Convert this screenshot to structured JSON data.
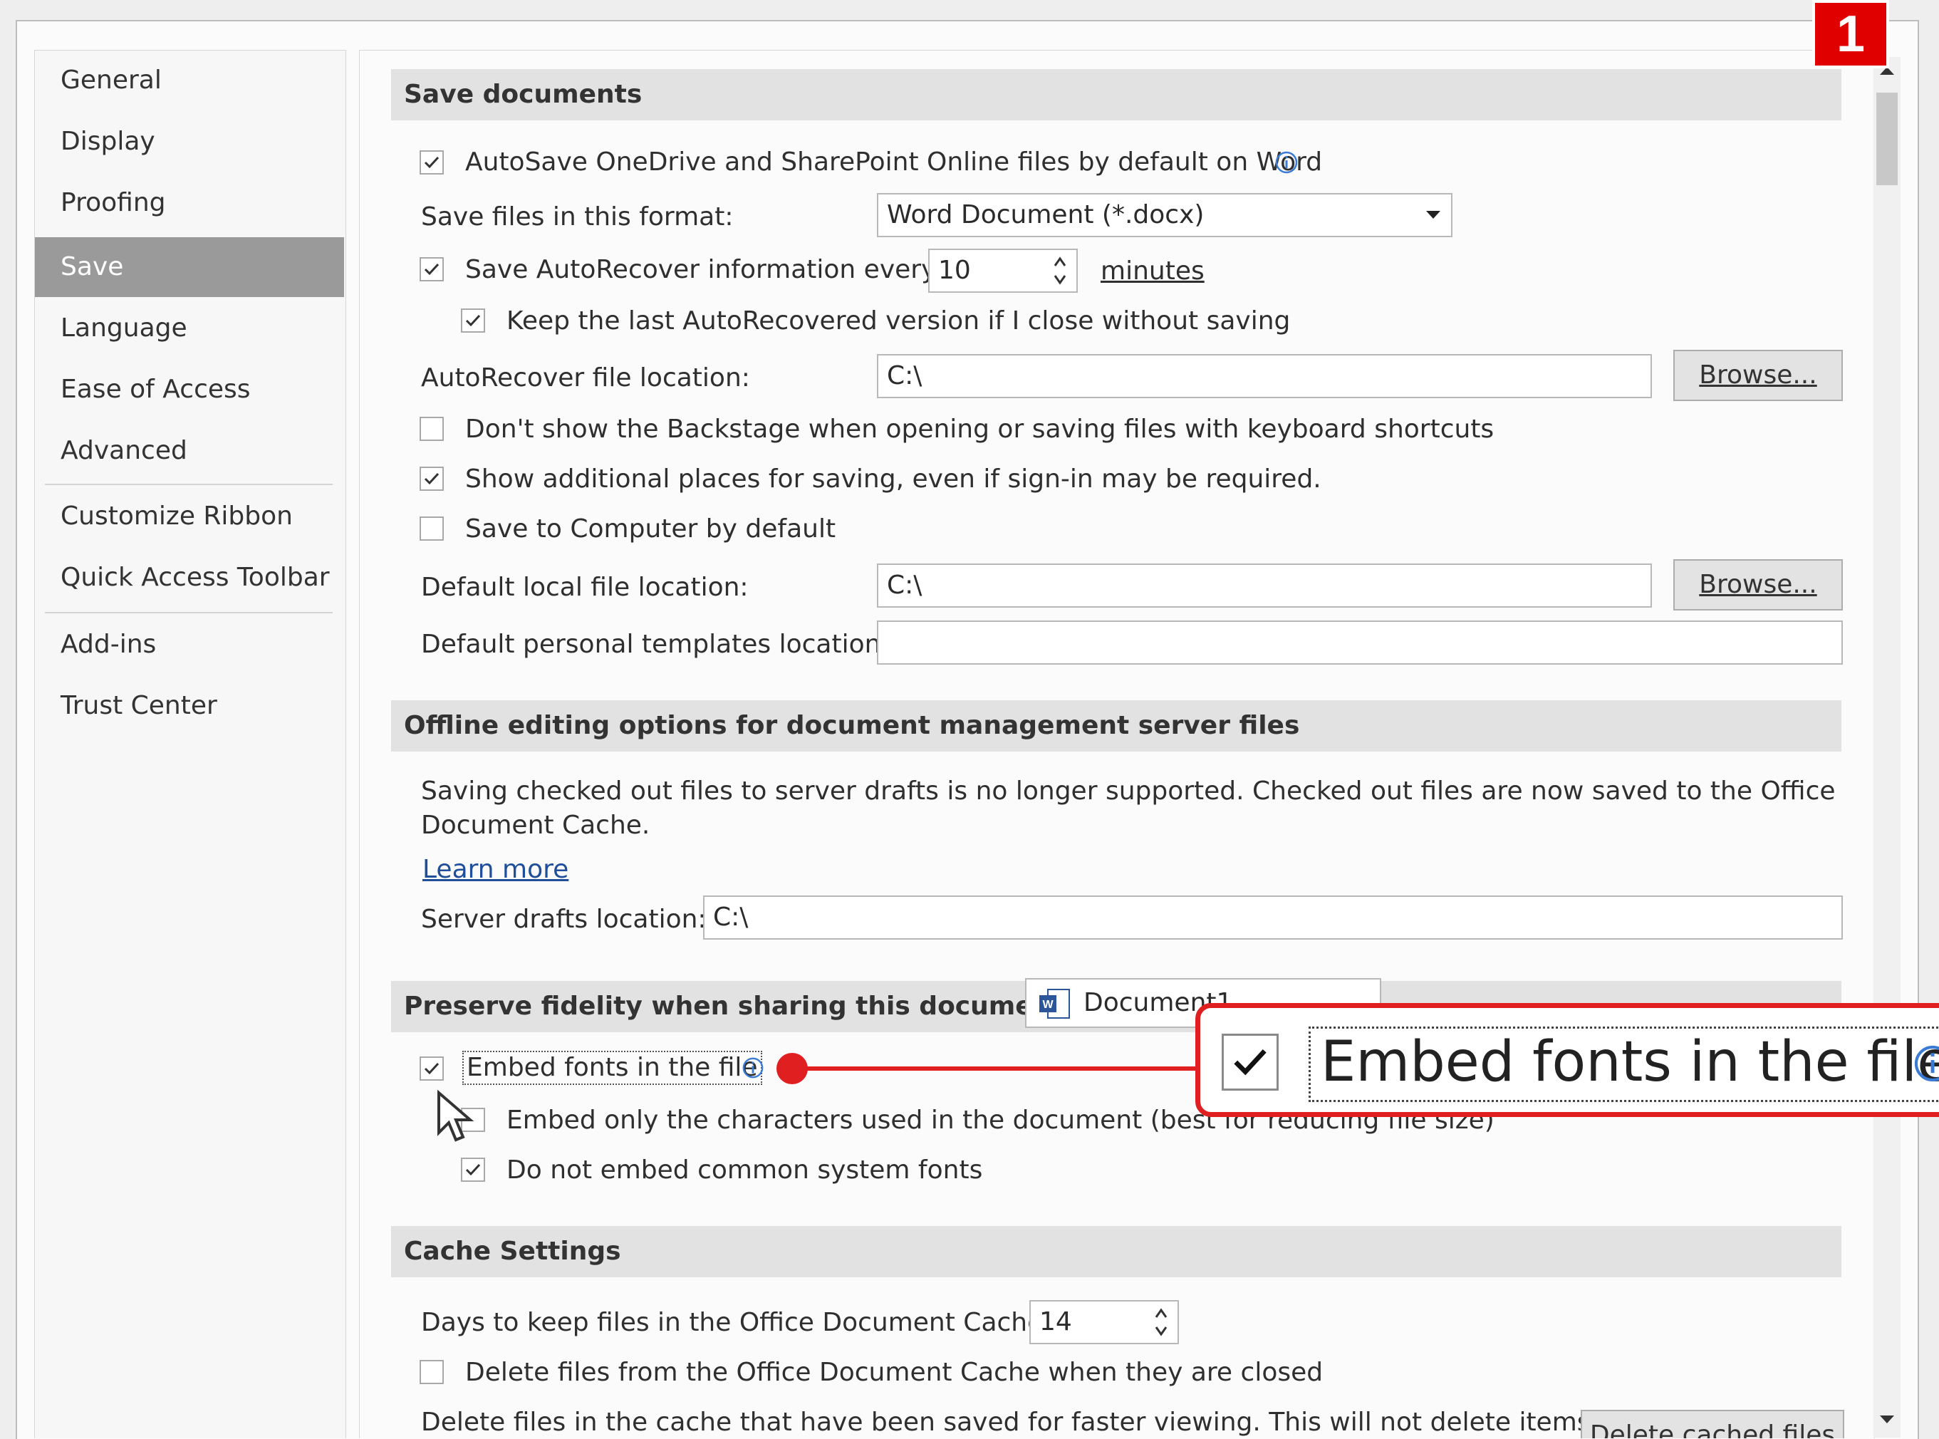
{
  "badge": "1",
  "nav": {
    "items": [
      {
        "label": "General"
      },
      {
        "label": "Display"
      },
      {
        "label": "Proofing"
      },
      {
        "label": "Save"
      },
      {
        "label": "Language"
      },
      {
        "label": "Ease of Access"
      },
      {
        "label": "Advanced"
      },
      {
        "label": "Customize Ribbon"
      },
      {
        "label": "Quick Access Toolbar"
      },
      {
        "label": "Add-ins"
      },
      {
        "label": "Trust Center"
      }
    ],
    "active": "Save"
  },
  "save": {
    "header": "Save documents",
    "autosave": {
      "label": "AutoSave OneDrive and SharePoint Online files by default on Word",
      "checked": true
    },
    "format": {
      "label": "Save files in this format:",
      "value": "Word Document (*.docx)"
    },
    "autorecover": {
      "label": "Save AutoRecover information every",
      "checked": true,
      "value": "10",
      "unit": "minutes"
    },
    "keep_last": {
      "label": "Keep the last AutoRecovered version if I close without saving",
      "checked": true
    },
    "autorecover_location": {
      "label": "AutoRecover file location:",
      "value": "C:\\",
      "button": "Browse..."
    },
    "no_backstage": {
      "label": "Don't show the Backstage when opening or saving files with keyboard shortcuts",
      "checked": false
    },
    "additional_places": {
      "label": "Show additional places for saving, even if sign-in may be required.",
      "checked": true
    },
    "save_to_computer": {
      "label": "Save to Computer by default",
      "checked": false
    },
    "default_local": {
      "label": "Default local file location:",
      "value": "C:\\",
      "button": "Browse..."
    },
    "templates": {
      "label": "Default personal templates location:",
      "value": ""
    }
  },
  "offline": {
    "header": "Offline editing options for document management server files",
    "text1": "Saving checked out files to server drafts is no longer supported. Checked out files are now saved to the Office",
    "text2": "Document Cache.",
    "learn_more": "Learn more",
    "server_drafts": {
      "label": "Server drafts location:",
      "value": "C:\\"
    }
  },
  "fidelity": {
    "header": "Preserve fidelity when sharing this document:",
    "document": "Document1",
    "embed_fonts": {
      "label": "Embed fonts in the file",
      "checked": true
    },
    "embed_only": {
      "label": "Embed only the characters used in the document (best for reducing file size)",
      "checked": false
    },
    "no_common": {
      "label": "Do not embed common system fonts",
      "checked": true
    }
  },
  "cache": {
    "header": "Cache Settings",
    "days": {
      "label": "Days to keep files in the Office Document Cache:",
      "value": "14"
    },
    "delete_closed": {
      "label": "Delete files from the Office Document Cache when they are closed",
      "checked": false
    },
    "delete_text": "Delete files in the cache that have been saved for faster viewing. This will not delete items",
    "delete_button": "Delete cached files"
  },
  "callout": {
    "label": "Embed fonts in the file"
  },
  "colors": {
    "accent_red": "#e02020",
    "nav_active": "#9a9a9a",
    "section_bg": "#e2e2e2"
  }
}
